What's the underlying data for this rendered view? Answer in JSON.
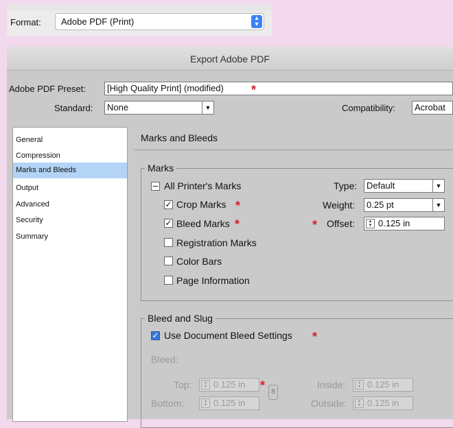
{
  "format": {
    "label": "Format:",
    "value": "Adobe PDF (Print)"
  },
  "dialog": {
    "title": "Export Adobe PDF",
    "preset_label": "Adobe PDF Preset:",
    "preset_value": "[High Quality Print] (modified)",
    "standard_label": "Standard:",
    "standard_value": "None",
    "compatibility_label": "Compatibility:",
    "compatibility_value": "Acrobat"
  },
  "sidebar": {
    "items": [
      {
        "label": "General"
      },
      {
        "label": "Compression"
      },
      {
        "label": "Marks and Bleeds",
        "selected": true
      },
      {
        "label": "Output"
      },
      {
        "label": "Advanced"
      },
      {
        "label": "Security"
      },
      {
        "label": "Summary"
      }
    ]
  },
  "panel": {
    "title": "Marks and Bleeds",
    "marks": {
      "group_title": "Marks",
      "all_printers_marks": "All Printer's Marks",
      "crop_marks": {
        "label": "Crop Marks",
        "checked": true
      },
      "bleed_marks": {
        "label": "Bleed Marks",
        "checked": true
      },
      "registration_marks": {
        "label": "Registration Marks",
        "checked": false
      },
      "color_bars": {
        "label": "Color Bars",
        "checked": false
      },
      "page_information": {
        "label": "Page Information",
        "checked": false
      },
      "type_label": "Type:",
      "type_value": "Default",
      "weight_label": "Weight:",
      "weight_value": "0.25 pt",
      "offset_label": "Offset:",
      "offset_value": "0.125 in"
    },
    "bleed": {
      "group_title": "Bleed and Slug",
      "use_doc_bleed": {
        "label": "Use Document Bleed Settings",
        "checked": true
      },
      "bleed_label": "Bleed:",
      "top_label": "Top:",
      "top_value": "0.125 in",
      "bottom_label": "Bottom:",
      "bottom_value": "0.125 in",
      "inside_label": "Inside:",
      "inside_value": "0.125 in",
      "outside_label": "Outside:",
      "outside_value": "0.125 in"
    }
  },
  "colors": {
    "background": "#f2d9ed",
    "selection": "#b3d4f5",
    "star": "#d32030",
    "checkbox_accent": "#3a78d6"
  },
  "marker_glyph": "*",
  "check_glyph": "✓"
}
